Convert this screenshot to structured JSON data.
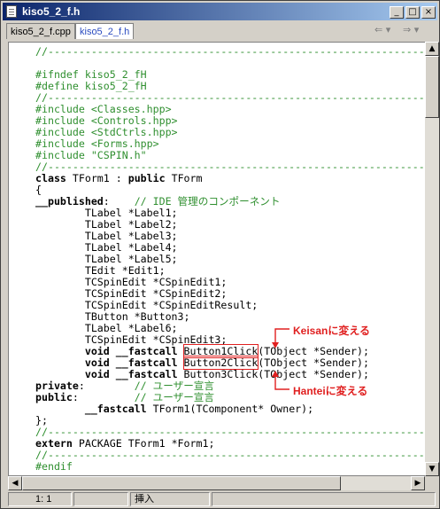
{
  "window": {
    "title": "kiso5_2_f.h"
  },
  "tabs": [
    {
      "label": "kiso5_2_f.cpp"
    },
    {
      "label": "kiso5_2_f.h"
    }
  ],
  "nav": {
    "back": "⇐ ▾",
    "forward": "⇒ ▾"
  },
  "code_lines": [
    "//---------------------------------------------------------------------------",
    "",
    "#ifndef kiso5_2_fH",
    "#define kiso5_2_fH",
    "//---------------------------------------------------------------------------",
    "#include <Classes.hpp>",
    "#include <Controls.hpp>",
    "#include <StdCtrls.hpp>",
    "#include <Forms.hpp>",
    "#include \"CSPIN.h\"",
    "//---------------------------------------------------------------------------",
    "class TForm1 : public TForm",
    "{",
    "__published:    // IDE 管理のコンポーネント",
    "        TLabel *Label1;",
    "        TLabel *Label2;",
    "        TLabel *Label3;",
    "        TLabel *Label4;",
    "        TLabel *Label5;",
    "        TEdit *Edit1;",
    "        TCSpinEdit *CSpinEdit1;",
    "        TCSpinEdit *CSpinEdit2;",
    "        TCSpinEdit *CSpinEditResult;",
    "        TButton *Button3;",
    "        TLabel *Label6;",
    "        TCSpinEdit *CSpinEdit3;",
    "        void __fastcall Button1Click(TObject *Sender);",
    "        void __fastcall Button2Click(TObject *Sender);",
    "        void __fastcall Button3Click(TObject *Sender);",
    "private:        // ユーザー宣言",
    "public:         // ユーザー宣言",
    "        __fastcall TForm1(TComponent* Owner);",
    "};",
    "//---------------------------------------------------------------------------",
    "extern PACKAGE TForm1 *Form1;",
    "//---------------------------------------------------------------------------",
    "#endif"
  ],
  "annotations": {
    "keisan": "Keisanに変える",
    "hantei": "Hanteiに変える"
  },
  "status": {
    "position": "1:   1",
    "mode": "挿入"
  },
  "colors": {
    "annotation": "#e02020",
    "comment": "#2f8f2f",
    "japanese": "#1a2aa8",
    "title_gradient_start": "#0a246a"
  }
}
